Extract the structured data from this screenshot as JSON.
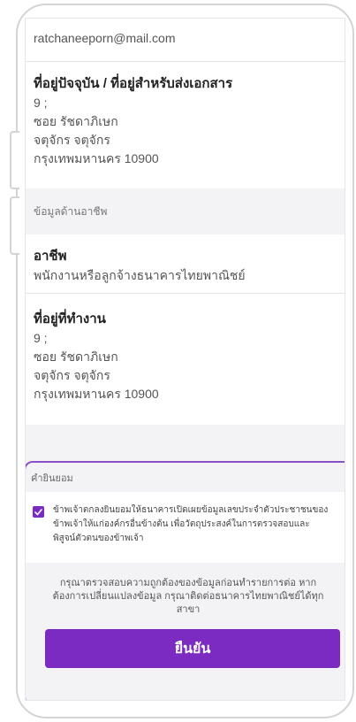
{
  "contact": {
    "email": "ratchaneeporn@mail.com"
  },
  "current_address": {
    "heading": "ที่อยู่ปัจจุบัน / ที่อยู่สำหรับส่งเอกสาร",
    "lines": [
      "9 ;",
      "ซอย รัชดาภิเษก",
      "จตุจักร จตุจักร",
      "กรุงเทพมหานคร 10900"
    ]
  },
  "occupation_section": {
    "label": "ข้อมูลด้านอาชีพ"
  },
  "occupation": {
    "heading": "อาชีพ",
    "value": "พนักงานหรือลูกจ้างธนาคารไทยพาณิชย์"
  },
  "work_address": {
    "heading": "ที่อยู่ที่ทำงาน",
    "lines": [
      "9 ;",
      "ซอย รัชดาภิเษก",
      "จตุจักร จตุจักร",
      "กรุงเทพมหานคร 10900"
    ]
  },
  "consent": {
    "title": "คำยินยอม",
    "checked": true,
    "text_lines": [
      "ข้าพเจ้าตกลงยินยอมให้ธนาคารเปิดเผยข้อมูลเลขประจำตัวประชาชนของ",
      "ข้าพเจ้าให้แก่องค์กรอื่นข้างต้น เพื่อวัตถุประสงค์ในการตรวจสอบและ",
      "พิสูจน์ตัวตนของข้าพเจ้า"
    ],
    "notice_lines": [
      "กรุณาตรวจสอบความถูกต้องของข้อมูลก่อนทำรายการต่อ หาก",
      "ต้องการเปลี่ยนแปลงข้อมูล กรุณาติดต่อธนาคารไทยพาณิชย์ได้ทุก",
      "สาขา"
    ],
    "confirm_label": "ยืนยัน"
  },
  "colors": {
    "accent": "#7b2ac2",
    "highlight_border": "#8a52c8",
    "background": "#f3f3f5"
  }
}
